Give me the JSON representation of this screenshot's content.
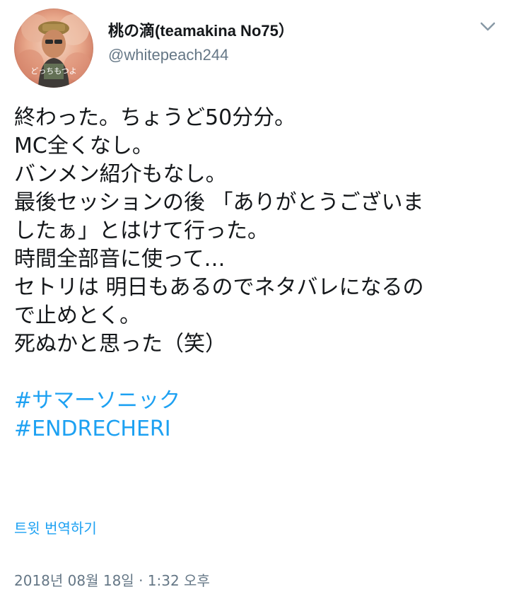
{
  "user": {
    "display_name": "桃の滴(teamakina No75）",
    "handle": "@whitepeach244",
    "avatar_caption": "どっちもつよ"
  },
  "tweet": {
    "lines": [
      "終わった。ちょうど50分分。",
      "MC全くなし。",
      "バンメン紹介もなし。",
      "最後セッションの後 「ありがとうございま",
      "したぁ」とはけて行った。",
      "時間全部音に使って…",
      "セトリは 明日もあるのでネタバレになるの",
      "で止めとく。",
      "死ぬかと思った（笑）"
    ],
    "hashtags": [
      "#サマーソニック",
      "#ENDRECHERI"
    ]
  },
  "translate_label": "트윗 번역하기",
  "timestamp": "2018년 08월 18일 · 1:32 오후",
  "colors": {
    "link": "#1da1f2",
    "text": "#14171a",
    "muted": "#657786"
  },
  "icons": {
    "caret": "chevron-down-icon"
  }
}
